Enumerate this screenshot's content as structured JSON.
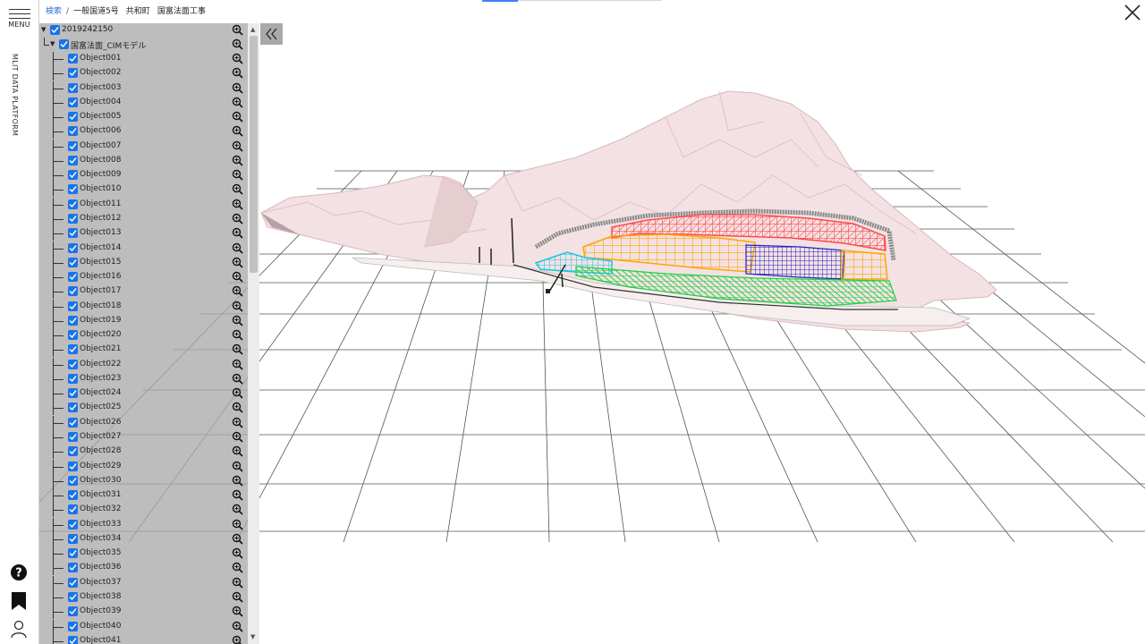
{
  "menu_label": "MENU",
  "platform_label": "MLIT DATA PLATFORM",
  "breadcrumb": {
    "search": "検索",
    "separator": "/",
    "items": [
      "一般国道5号",
      "共和町",
      "国富法面工事"
    ]
  },
  "tree": {
    "root": "2019242150",
    "model": "国富法面_CIMモデル",
    "objects": [
      "Object001",
      "Object002",
      "Object003",
      "Object004",
      "Object005",
      "Object006",
      "Object007",
      "Object008",
      "Object009",
      "Object010",
      "Object011",
      "Object012",
      "Object013",
      "Object014",
      "Object015",
      "Object016",
      "Object017",
      "Object018",
      "Object019",
      "Object020",
      "Object021",
      "Object022",
      "Object023",
      "Object024",
      "Object025",
      "Object026",
      "Object027",
      "Object028",
      "Object029",
      "Object030",
      "Object031",
      "Object032",
      "Object033",
      "Object034",
      "Object035",
      "Object036",
      "Object037",
      "Object038",
      "Object039",
      "Object040",
      "Object041"
    ]
  },
  "icons": {
    "menu": "hamburger-icon",
    "help": "help-icon",
    "bookmark": "bookmark-icon",
    "user": "user-icon",
    "close": "close-icon",
    "zoom": "zoom-icon",
    "collapse": "double-chevron-left-icon"
  },
  "colors": {
    "accent": "#2d6fd6",
    "checkbox": "#1a73e8",
    "panel": "#aaaaaa",
    "terrain": "#f3e1e3",
    "mesh_red": "#ff4a4a",
    "mesh_orange": "#ffa500",
    "mesh_blue": "#2020c0",
    "mesh_green": "#20d040",
    "mesh_cyan": "#18c8e0"
  }
}
